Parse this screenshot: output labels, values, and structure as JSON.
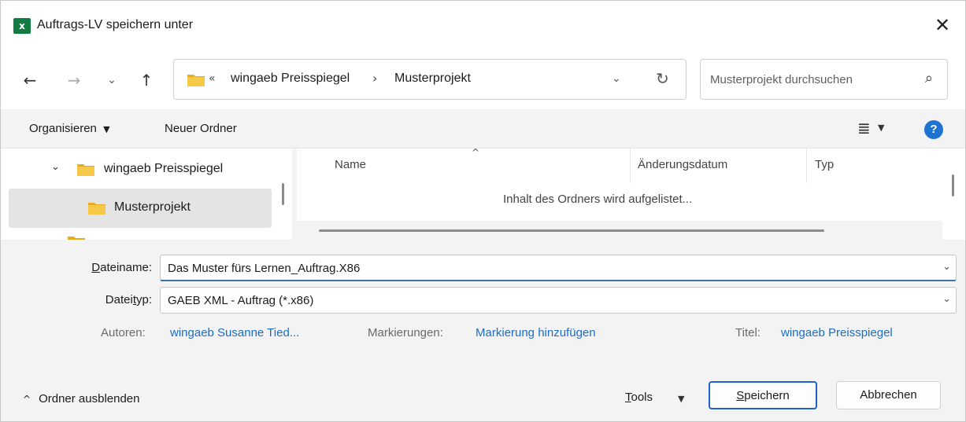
{
  "window": {
    "title": "Auftrags-LV speichern unter",
    "app_icon": "excel-icon",
    "app_icon_letter": "x",
    "close_glyph": "✕"
  },
  "nav": {
    "back_glyph": "←",
    "forward_glyph": "→",
    "recent_glyph": "⌄",
    "up_glyph": "↑"
  },
  "address": {
    "overflow_glyph": "«",
    "segments": [
      "wingaeb Preisspiegel",
      "Musterprojekt"
    ],
    "separator": "›",
    "dropdown_glyph": "⌄",
    "refresh_glyph": "↻"
  },
  "search": {
    "placeholder": "Musterprojekt durchsuchen",
    "icon": "⌕"
  },
  "toolbar": {
    "organize_label": "Organisieren",
    "organize_caret": "▼",
    "new_folder_label": "Neuer Ordner",
    "view_glyph": "≣",
    "view_caret": "▼",
    "help_glyph": "?"
  },
  "tree": {
    "expand_glyph": "⌄",
    "items": [
      {
        "label": "wingaeb Preisspiegel",
        "expanded": true
      },
      {
        "label": "Musterprojekt",
        "selected": true
      }
    ]
  },
  "filelist": {
    "columns": [
      "Name",
      "Änderungsdatum",
      "Typ"
    ],
    "sort_glyph": "^",
    "status": "Inhalt des Ordners wird aufgelistet..."
  },
  "form": {
    "filename_label_pre": "D",
    "filename_label_post": "ateiname:",
    "filename_value": "Das Muster fürs Lernen_Auftrag.X86",
    "filetype_label_pre": "Datei",
    "filetype_label_u": "t",
    "filetype_label_post": "yp:",
    "filetype_value": "GAEB XML - Auftrag (*.x86)",
    "field_caret": "⌄"
  },
  "meta": {
    "authors_label": "Autoren:",
    "authors_value": "wingaeb Susanne Tied...",
    "tags_label": "Markierungen:",
    "tags_value": "Markierung hinzufügen",
    "title_label": "Titel:",
    "title_value": "wingaeb Preisspiegel"
  },
  "footer": {
    "toggle_caret": "^",
    "toggle_label": "Ordner ausblenden",
    "tools_u": "T",
    "tools_rest": "ools",
    "tools_caret": "▼",
    "save_u": "S",
    "save_rest": "peichern",
    "cancel_label": "Abbrechen"
  },
  "colors": {
    "accent": "#1f63c6",
    "link": "#1a6dc8",
    "folder": "#f4c542",
    "excel_green": "#107c41"
  }
}
